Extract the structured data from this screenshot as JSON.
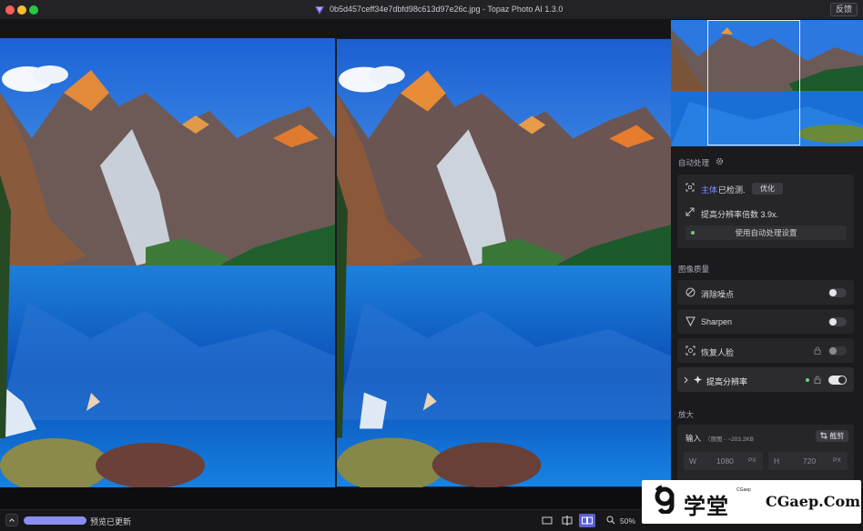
{
  "window": {
    "title": "0b5d457ceff34e7dbfd98c613d97e26c.jpg - Topaz Photo AI 1.3.0",
    "feedback_label": "反馈"
  },
  "panel": {
    "auto_section": "自动处理",
    "subject_label": "主体",
    "subject_status": "已检测.",
    "optimize_label": "优化",
    "upscale_factor": "提高分辨率倍数 3.9x.",
    "use_auto_label": "使用自动处理设置",
    "quality_section": "图像质量",
    "filters": [
      {
        "label": "消除噪点",
        "state": "off"
      },
      {
        "label": "Sharpen",
        "state": "off"
      },
      {
        "label": "恢复人脸",
        "state": "locked-off"
      },
      {
        "label": "提高分辨率",
        "state": "on"
      }
    ],
    "enlarge_section": "放大",
    "input_label": "输入",
    "input_meta": "（原图 - ~203.2KB",
    "crop_label": "截剪",
    "width_label": "W",
    "width_value": "1080",
    "height_label": "H",
    "height_value": "720",
    "unit": "PX"
  },
  "bottom": {
    "status": "预览已更新",
    "progress": 1.0,
    "view_mode_active": "side-by-side",
    "zoom": "50%"
  },
  "watermark": {
    "cn": "学堂",
    "vertical": "CGaep",
    "en": "CGaep.Com"
  },
  "colors": {
    "accent": "#5a5fd8",
    "progress": "#8a8ef0",
    "panel_bg": "#1b1b1f",
    "active_dot": "#6dd36b"
  }
}
